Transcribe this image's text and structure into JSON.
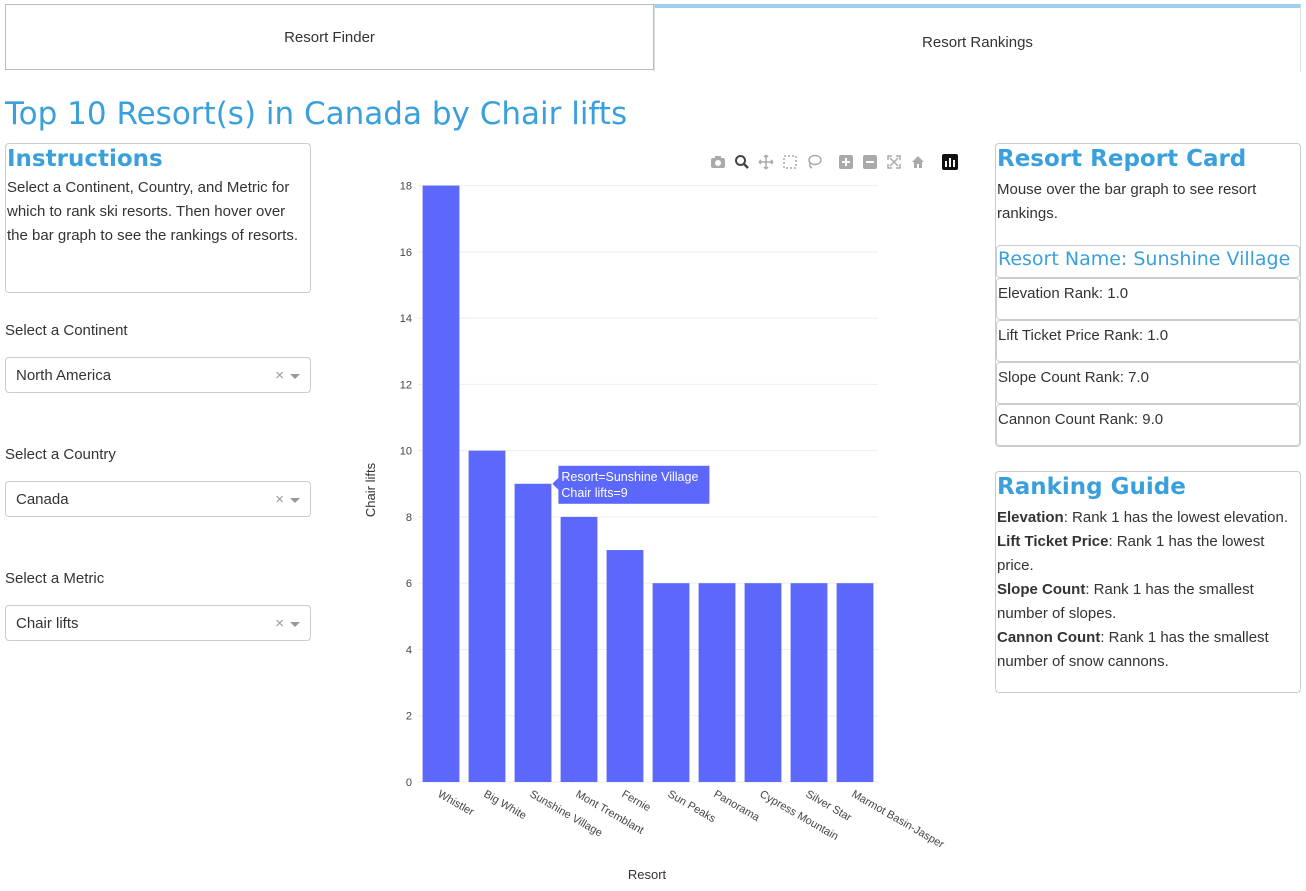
{
  "tabs": [
    {
      "label": "Resort Finder"
    },
    {
      "label": "Resort Rankings"
    }
  ],
  "page_title": "Top 10 Resort(s) in Canada by Chair lifts",
  "instructions": {
    "title": "Instructions",
    "text": "Select a Continent, Country, and Metric for which to rank ski resorts. Then hover over the bar graph to see the rankings of resorts."
  },
  "controls": {
    "continent": {
      "label": "Select a Continent",
      "value": "North America"
    },
    "country": {
      "label": "Select a Country",
      "value": "Canada"
    },
    "metric": {
      "label": "Select a Metric",
      "value": "Chair lifts"
    },
    "clear_glyph": "×"
  },
  "modebar": {
    "icons": [
      "camera-icon",
      "zoom-icon",
      "pan-icon",
      "box-select-icon",
      "lasso-icon",
      "zoom-in-icon",
      "zoom-out-icon",
      "autoscale-icon",
      "reset-axes-icon",
      "plotly-logo-icon"
    ]
  },
  "chart_data": {
    "type": "bar",
    "categories": [
      "Whistler",
      "Big White",
      "Sunshine Village",
      "Mont Tremblant",
      "Fernie",
      "Sun Peaks",
      "Panorama",
      "Cypress Mountain",
      "Silver Star",
      "Marmot Basin-Jasper"
    ],
    "values": [
      18,
      10,
      9,
      8,
      7,
      6,
      6,
      6,
      6,
      6
    ],
    "xlabel": "Resort",
    "ylabel": "Chair lifts",
    "ylim": [
      0,
      18.5
    ],
    "yticks": [
      0,
      2,
      4,
      6,
      8,
      10,
      12,
      14,
      16,
      18
    ],
    "grid": true,
    "bar_color": "#5b68fb",
    "tooltip": {
      "line1": "Resort=Sunshine Village",
      "line2": "Chair lifts=9",
      "index": 2
    }
  },
  "report_card": {
    "title": "Resort Report Card",
    "hint": "Mouse over the bar graph to see resort rankings.",
    "resort_name": "Resort Name: Sunshine Village",
    "ranks": [
      "Elevation Rank: 1.0",
      "Lift Ticket Price Rank: 1.0",
      "Slope Count Rank: 7.0",
      "Cannon Count Rank: 9.0"
    ]
  },
  "guide": {
    "title": "Ranking Guide",
    "items": [
      {
        "term": "Elevation",
        "desc": ": Rank 1 has the lowest elevation."
      },
      {
        "term": "Lift Ticket Price",
        "desc": ": Rank 1 has the lowest price."
      },
      {
        "term": "Slope Count",
        "desc": ": Rank 1 has the smallest number of slopes."
      },
      {
        "term": "Cannon Count",
        "desc": ": Rank 1 has the smallest number of snow cannons."
      }
    ]
  },
  "colors": {
    "accent": "#3aa0dc",
    "bar": "#5b68fb",
    "tab_active": "#9dd0ef"
  }
}
